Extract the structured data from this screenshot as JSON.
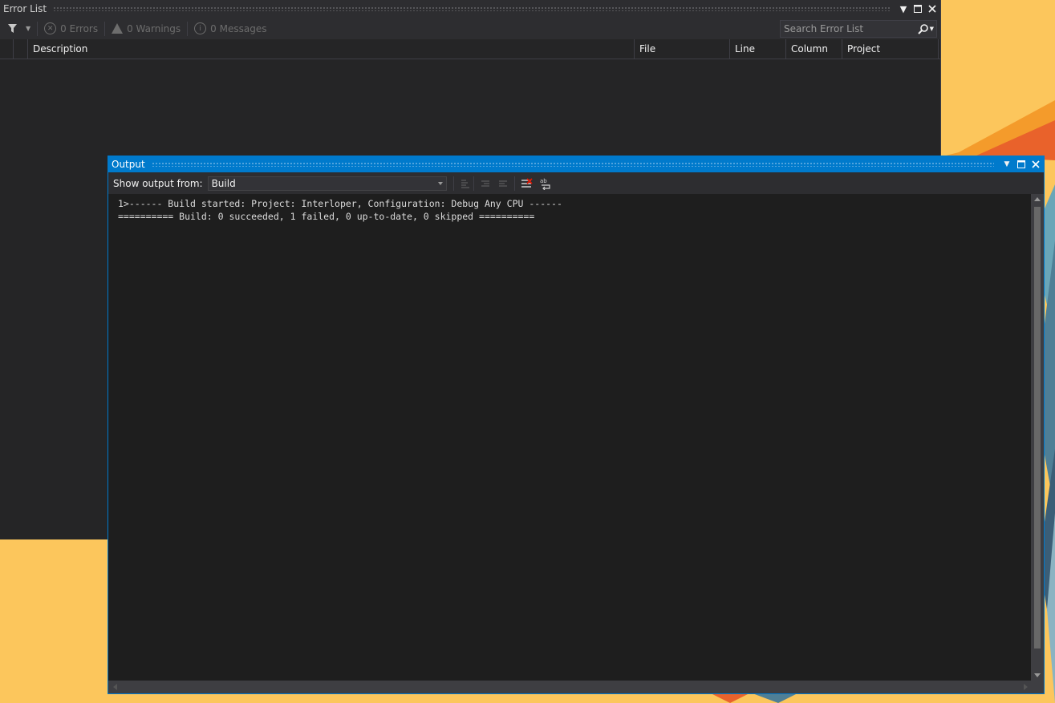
{
  "colors": {
    "accent": "#007acc",
    "panel_bg": "#252526",
    "toolbar_bg": "#2d2d30",
    "desktop_bg": "#fcc65c",
    "disabled_text": "#6d6d6d"
  },
  "error_list": {
    "title": "Error List",
    "errors_label": "0 Errors",
    "warnings_label": "0 Warnings",
    "messages_label": "0 Messages",
    "search_placeholder": "Search Error List",
    "columns": {
      "description": "Description",
      "file": "File",
      "line": "Line",
      "column": "Column",
      "project": "Project"
    }
  },
  "output": {
    "title": "Output",
    "show_output_from_label": "Show output from:",
    "source_selected": "Build",
    "lines": [
      "1>------ Build started: Project: Interloper, Configuration: Debug Any CPU ------",
      "========== Build: 0 succeeded, 1 failed, 0 up-to-date, 0 skipped =========="
    ]
  }
}
